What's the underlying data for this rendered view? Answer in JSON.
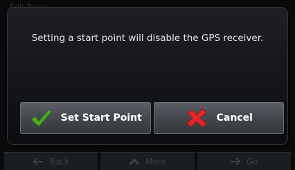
{
  "background": {
    "title": "Edit Route",
    "nav": [
      {
        "label": "Back",
        "icon": "arrow-left-icon"
      },
      {
        "label": "More",
        "icon": "chevron-up-icon"
      },
      {
        "label": "Go",
        "icon": "arrow-right-icon"
      }
    ]
  },
  "dialog": {
    "message": "Setting a start point will disable the GPS receiver.",
    "confirm_label": "Set Start Point",
    "confirm_icon": "checkmark-icon",
    "cancel_label": "Cancel",
    "cancel_icon": "cross-icon"
  },
  "colors": {
    "check_green": "#4caf1f",
    "cross_red": "#e0262c"
  }
}
